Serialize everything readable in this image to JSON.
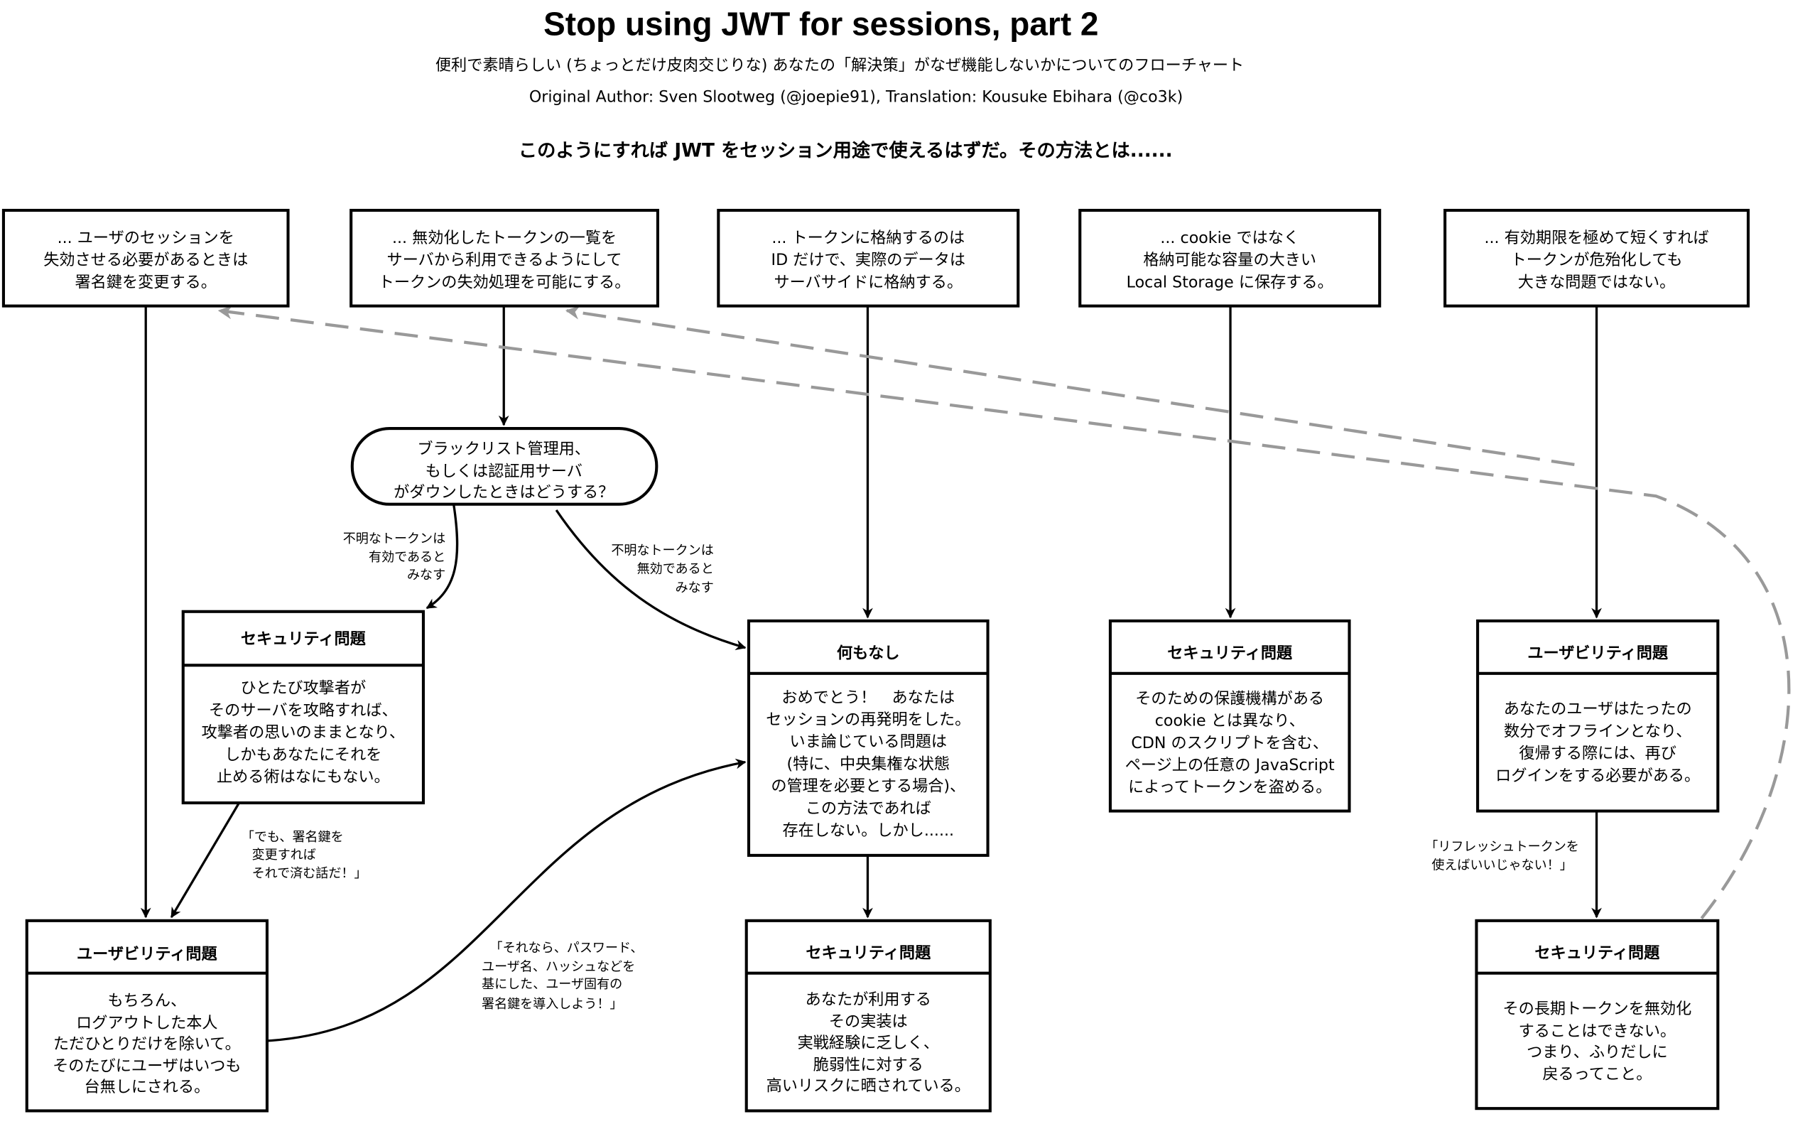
{
  "header": {
    "title": "Stop using JWT for sessions, part 2",
    "subtitle": "便利で素晴らしい (ちょっとだけ皮肉交じりな) あなたの「解決策」がなぜ機能しないかについてのフローチャート",
    "credits": "Original Author: Sven Slootweg (@joepie91), Translation: Kousuke Ebihara (@co3k)",
    "question": "このようにすれば JWT をセッション用途で使えるはずだ。その方法とは......"
  },
  "solutions": [
    {
      "id": "change-key",
      "lines": [
        "... ユーザのセッションを",
        "失効させる必要があるときは",
        "署名鍵を変更する。"
      ]
    },
    {
      "id": "blacklist",
      "lines": [
        "... 無効化したトークンの一覧を",
        "サーバから利用できるようにして",
        "トークンの失効処理を可能にする。"
      ]
    },
    {
      "id": "store-id",
      "lines": [
        "... トークンに格納するのは",
        "ID だけで、実際のデータは",
        "サーバサイドに格納する。"
      ]
    },
    {
      "id": "local-storage",
      "lines": [
        "... cookie ではなく",
        "格納可能な容量の大きい",
        "Local Storage に保存する。"
      ]
    },
    {
      "id": "short-expiry",
      "lines": [
        "... 有効期限を極めて短くすれば",
        "トークンが危殆化しても",
        "大きな問題ではない。"
      ]
    }
  ],
  "decision": {
    "lines": [
      "ブラックリスト管理用、",
      "もしくは認証用サーバ",
      "がダウンしたときはどうする？"
    ]
  },
  "problems": [
    {
      "id": "security-server",
      "title": "セキュリティ問題",
      "lines": [
        "ひとたび攻撃者が",
        "そのサーバを攻略すれば、",
        "攻撃者の思いのままとなり、",
        "しかもあなたにそれを",
        "止める術はなにもない。"
      ]
    },
    {
      "id": "nothing",
      "title": "何もなし",
      "lines": [
        "おめでとう！　あなたは",
        "セッションの再発明をした。",
        "いま論じている問題は",
        "(特に、中央集権な状態",
        "の管理を必要とする場合)、",
        "この方法であれば",
        "存在しない。しかし......"
      ]
    },
    {
      "id": "security-xss",
      "title": "セキュリティ問題",
      "lines": [
        "そのための保護機構がある",
        "cookie とは異なり、",
        "CDN のスクリプトを含む、",
        "ページ上の任意の JavaScript",
        "によってトークンを盗める。"
      ]
    },
    {
      "id": "usability-offline",
      "title": "ユーザビリティ問題",
      "lines": [
        "あなたのユーザはたったの",
        "数分でオフラインとなり、",
        "復帰する際には、再び",
        "ログインをする必要がある。"
      ]
    },
    {
      "id": "usability-logout",
      "title": "ユーザビリティ問題",
      "lines": [
        "もちろん、",
        "ログアウトした本人",
        "ただひとりだけを除いて。",
        "そのたびにユーザはいつも",
        "台無しにされる。"
      ]
    },
    {
      "id": "security-impl",
      "title": "セキュリティ問題",
      "lines": [
        "あなたが利用する",
        "その実装は",
        "実戦経験に乏しく、",
        "脆弱性に対する",
        "高いリスクに晒されている。"
      ]
    },
    {
      "id": "security-refresh",
      "title": "セキュリティ問題",
      "lines": [
        "その長期トークンを無効化",
        "することはできない。",
        "つまり、ふりだしに",
        "戻るってこと。"
      ]
    }
  ],
  "edge_labels": [
    {
      "id": "assume-valid",
      "lines": [
        "不明なトークンは",
        "有効であると",
        "みなす"
      ]
    },
    {
      "id": "assume-invalid",
      "lines": [
        "不明なトークンは",
        "無効であると",
        "みなす"
      ]
    },
    {
      "id": "change-key-quote",
      "lines": [
        "「でも、署名鍵を",
        "変更すれば",
        "それで済む話だ！」"
      ]
    },
    {
      "id": "per-user-key-quote",
      "lines": [
        "「それなら、パスワード、",
        "ユーザ名、ハッシュなどを",
        "基にした、ユーザ固有の",
        "署名鍵を導入しよう！」"
      ]
    },
    {
      "id": "refresh-token-quote",
      "lines": [
        "「リフレッシュトークンを",
        "使えばいいじゃない！」"
      ]
    }
  ],
  "colors": {
    "line": "#000000",
    "loop_back": "#999999",
    "background": "#ffffff"
  }
}
